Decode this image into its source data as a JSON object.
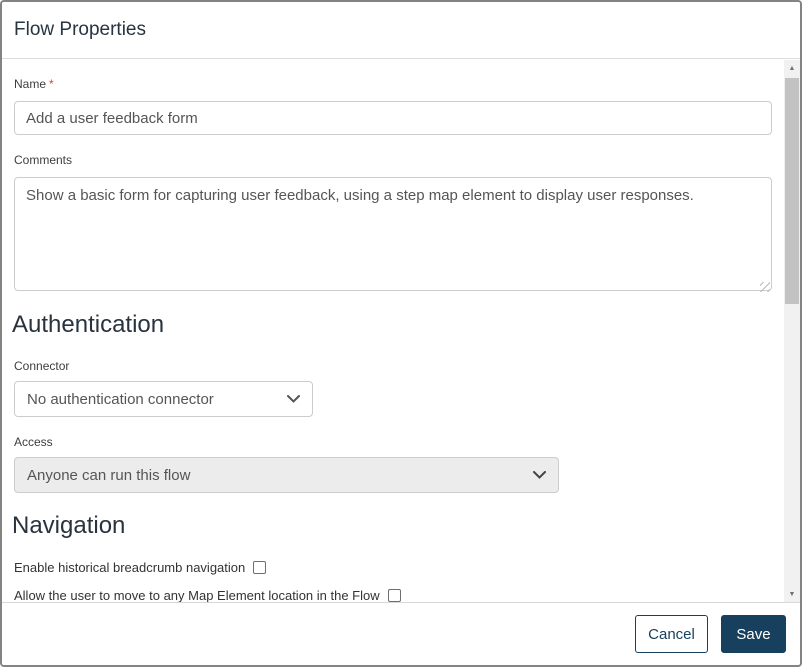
{
  "window": {
    "title": "Flow Properties"
  },
  "form": {
    "name": {
      "label": "Name",
      "required_marker": "*",
      "value": "Add a user feedback form"
    },
    "comments": {
      "label": "Comments",
      "value": "Show a basic form for capturing user feedback, using a step map element to display user responses."
    },
    "authentication": {
      "heading": "Authentication",
      "connector": {
        "label": "Connector",
        "selected_option": "No authentication connector"
      },
      "access": {
        "label": "Access",
        "selected_option": "Anyone can run this flow",
        "disabled": true
      }
    },
    "navigation": {
      "heading": "Navigation",
      "options": [
        {
          "label": "Enable historical breadcrumb navigation",
          "checked": false
        },
        {
          "label": "Allow the user to move to any Map Element location in the Flow",
          "checked": false
        }
      ]
    }
  },
  "footer": {
    "cancel_label": "Cancel",
    "save_label": "Save"
  },
  "icons": {
    "scroll_up": "▲",
    "scroll_down": "▼",
    "dropdown_chevron": "chevron-down"
  },
  "colors": {
    "primary": "#17405e",
    "required_asterisk": "#dc4437",
    "disabled_field_bg": "#ececec",
    "scrollbar_track": "#f1f1f1",
    "scrollbar_thumb": "#c2c2c2"
  }
}
